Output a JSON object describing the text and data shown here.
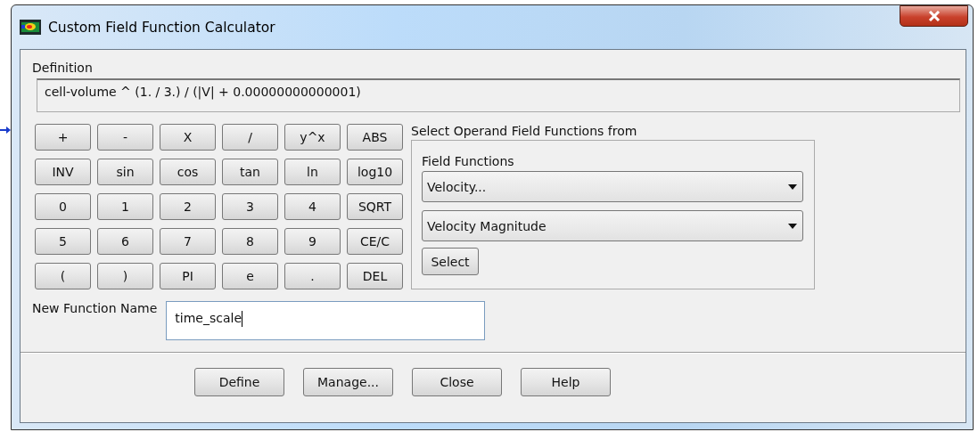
{
  "window": {
    "title": "Custom Field Function Calculator"
  },
  "definition": {
    "label": "Definition",
    "value": "cell-volume ^ (1. / 3.) / (|V| + 0.00000000000001)"
  },
  "keypad": [
    [
      "+",
      "-",
      "X",
      "/",
      "y^x",
      "ABS"
    ],
    [
      "INV",
      "sin",
      "cos",
      "tan",
      "ln",
      "log10"
    ],
    [
      "0",
      "1",
      "2",
      "3",
      "4",
      "SQRT"
    ],
    [
      "5",
      "6",
      "7",
      "8",
      "9",
      "CE/C"
    ],
    [
      "(",
      ")",
      "PI",
      "e",
      ".",
      "DEL"
    ]
  ],
  "operands": {
    "label": "Select Operand Field Functions from",
    "group_label": "Field Functions",
    "dropdowns": [
      {
        "value": "Velocity..."
      },
      {
        "value": "Velocity Magnitude"
      }
    ],
    "select_button": "Select"
  },
  "new_function": {
    "label": "New Function Name",
    "value": "time_scale"
  },
  "buttons": [
    "Define",
    "Manage...",
    "Close",
    "Help"
  ]
}
